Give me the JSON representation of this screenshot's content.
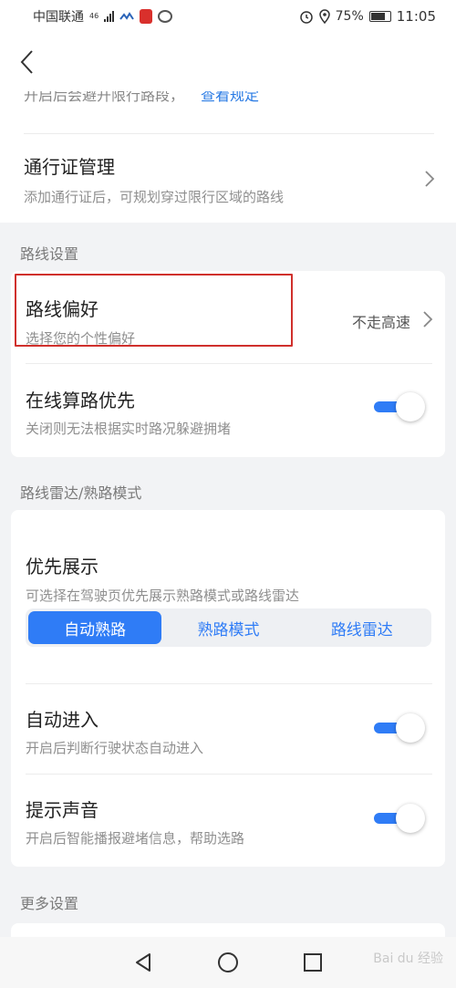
{
  "status_bar": {
    "carrier": "中国联通",
    "network": "46",
    "battery": "75%",
    "time": "11:05"
  },
  "cut_text": {
    "text": "开启后会避开限行路段，",
    "link": "查看规定"
  },
  "pass_management": {
    "title": "通行证管理",
    "subtitle": "添加通行证后，可规划穿过限行区域的路线"
  },
  "route_settings": {
    "section_title": "路线设置",
    "preference": {
      "title": "路线偏好",
      "subtitle": "选择您的个性偏好",
      "value": "不走高速"
    },
    "online_priority": {
      "title": "在线算路优先",
      "subtitle": "关闭则无法根据实时路况躲避拥堵",
      "enabled": true
    }
  },
  "radar_settings": {
    "section_title": "路线雷达/熟路模式",
    "priority_display": {
      "title": "优先展示",
      "subtitle": "可选择在驾驶页优先展示熟路模式或路线雷达",
      "options": [
        "自动熟路",
        "熟路模式",
        "路线雷达"
      ],
      "selected": "自动熟路"
    },
    "auto_enter": {
      "title": "自动进入",
      "subtitle": "开启后判断行驶状态自动进入",
      "enabled": true
    },
    "sound": {
      "title": "提示声音",
      "subtitle": "开启后智能播报避堵信息，帮助选路",
      "enabled": true
    }
  },
  "more_settings": {
    "section_title": "更多设置"
  },
  "watermark": "Bai du 经验",
  "colors": {
    "accent": "#2f7cf6",
    "highlight": "#d0302c",
    "background": "#f2f3f5"
  }
}
